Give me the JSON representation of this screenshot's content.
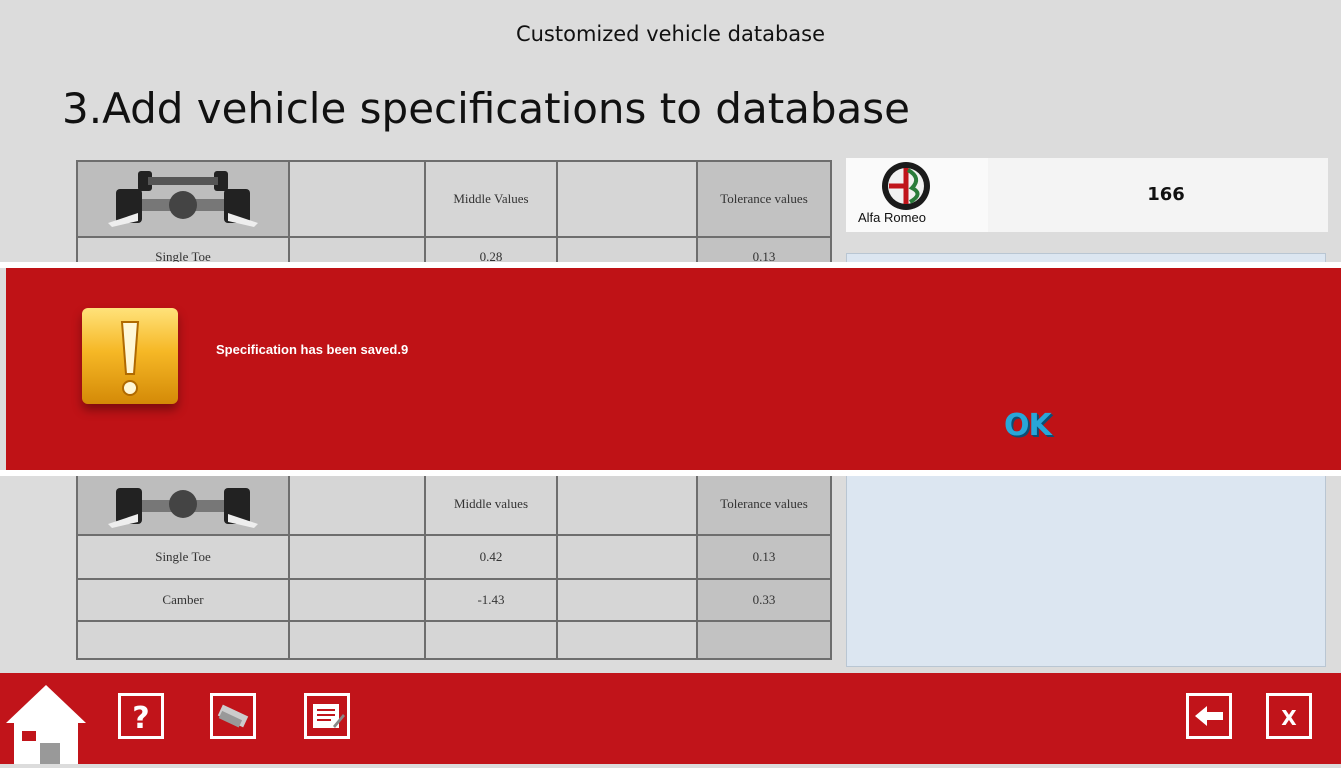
{
  "window": {
    "title": "Customized vehicle database"
  },
  "page": {
    "heading": "3.Add vehicle specifications to database"
  },
  "vehicle": {
    "brand": "Alfa Romeo",
    "model": "166"
  },
  "table_top": {
    "headers": [
      "",
      "",
      "Middle Values",
      "",
      "Tolerance values"
    ],
    "rows": [
      {
        "label": "Single Toe",
        "middle": "0.28",
        "tolerance": "0.13"
      }
    ]
  },
  "table_bottom": {
    "headers": [
      "",
      "",
      "Middle values",
      "",
      "Tolerance values"
    ],
    "rows": [
      {
        "label": "Single Toe",
        "middle": "0.42",
        "tolerance": "0.13"
      },
      {
        "label": "Camber",
        "middle": "-1.43",
        "tolerance": "0.33"
      },
      {
        "label": "",
        "middle": "",
        "tolerance": ""
      }
    ]
  },
  "alert": {
    "message": "Specification has been saved.9",
    "ok_label": "OK",
    "icon": "warning-icon"
  },
  "toolbar": {
    "left_icons": [
      "home-icon",
      "help-icon",
      "vehicle-tools-icon",
      "spec-sheet-icon"
    ],
    "right_icons": [
      "back-arrow-icon",
      "close-x-icon"
    ],
    "close_label": "X"
  },
  "colors": {
    "accent_red": "#c1141a",
    "alert_red": "#bf1216",
    "ok_blue": "#29a6d8",
    "panel_blue": "#dce6f1"
  }
}
